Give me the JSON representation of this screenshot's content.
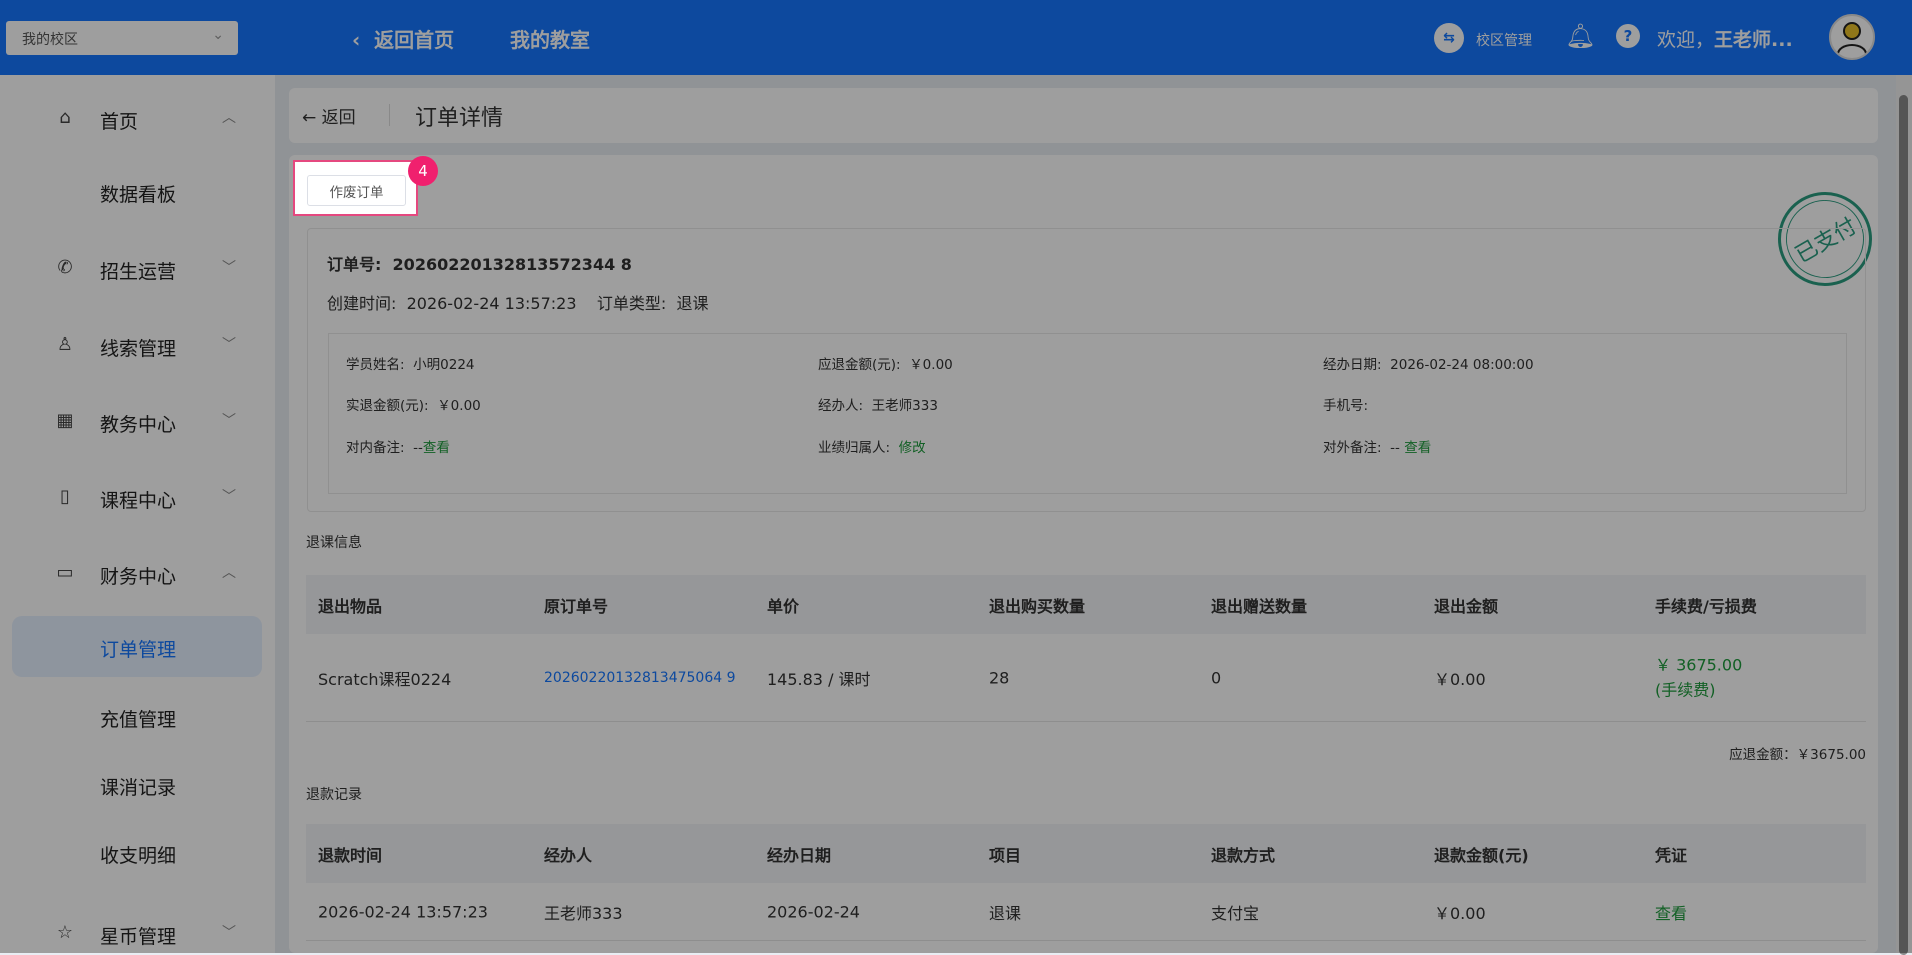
{
  "header": {
    "campus_select": "我的校区",
    "back_home": "返回首页",
    "my_classroom": "我的教室",
    "campus_manage": "校区管理",
    "welcome": "欢迎，",
    "user": "王老师..."
  },
  "sidebar": {
    "items": [
      {
        "label": "首页",
        "icon": "home-icon",
        "arrow": "^"
      },
      {
        "label": "数据看板"
      },
      {
        "label": "招生运营",
        "icon": "phone-icon",
        "arrow": "v"
      },
      {
        "label": "线索管理",
        "icon": "user-icon",
        "arrow": "v"
      },
      {
        "label": "教务中心",
        "icon": "building-icon",
        "arrow": "v"
      },
      {
        "label": "课程中心",
        "icon": "notebook-icon",
        "arrow": "v"
      },
      {
        "label": "财务中心",
        "icon": "card-icon",
        "arrow": "^"
      },
      {
        "label": "订单管理",
        "active": true
      },
      {
        "label": "充值管理"
      },
      {
        "label": "课消记录"
      },
      {
        "label": "收支明细"
      },
      {
        "label": "星币管理",
        "icon": "star-icon",
        "arrow": "v"
      }
    ]
  },
  "topbar": {
    "back": "返回",
    "title": "订单详情"
  },
  "actions": {
    "void_order": "作废订单",
    "step_badge": "4"
  },
  "stamp": "已支付",
  "order": {
    "no_label": "订单号:",
    "no": "20260220132813572344 8",
    "created_label": "创建时间:",
    "created": "2026-02-24 13:57:23",
    "type_label": "订单类型:",
    "type": "退课"
  },
  "details": [
    {
      "label": "学员姓名:",
      "value": "小明0224"
    },
    {
      "label": "应退金额(元):",
      "value": "￥0.00"
    },
    {
      "label": "经办日期:",
      "value": "2026-02-24 08:00:00"
    },
    {
      "label": "实退金额(元):",
      "value": "￥0.00"
    },
    {
      "label": "经办人:",
      "value": "王老师333"
    },
    {
      "label": "手机号:",
      "value": ""
    },
    {
      "label": "对内备注:",
      "value": "--",
      "link": "查看"
    },
    {
      "label": "业绩归属人:",
      "value": "",
      "link": "修改"
    },
    {
      "label": "对外备注:",
      "value": "-- ",
      "link": "查看"
    }
  ],
  "refund_section": {
    "title": "退课信息",
    "headers": [
      "退出物品",
      "原订单号",
      "单价",
      "退出购买数量",
      "退出赠送数量",
      "退出金额",
      "手续费/亏损费"
    ],
    "rows": [
      {
        "item": "Scratch课程0224",
        "orig_no": "20260220132813475064 9",
        "price": "145.83 / 课时",
        "qty": "28",
        "gift": "0",
        "amount": "￥0.00",
        "fee": "￥ 3675.00",
        "fee_note": "(手续费)"
      }
    ],
    "total": "应退金额：￥3675.00"
  },
  "records": {
    "title": "退款记录",
    "headers": [
      "退款时间",
      "经办人",
      "经办日期",
      "项目",
      "退款方式",
      "退款金额(元)",
      "凭证"
    ],
    "rows": [
      {
        "time": "2026-02-24 13:57:23",
        "handler": "王老师333",
        "date": "2026-02-24",
        "item": "退课",
        "method": "支付宝",
        "amount": "￥0.00",
        "voucher": "查看"
      }
    ]
  }
}
